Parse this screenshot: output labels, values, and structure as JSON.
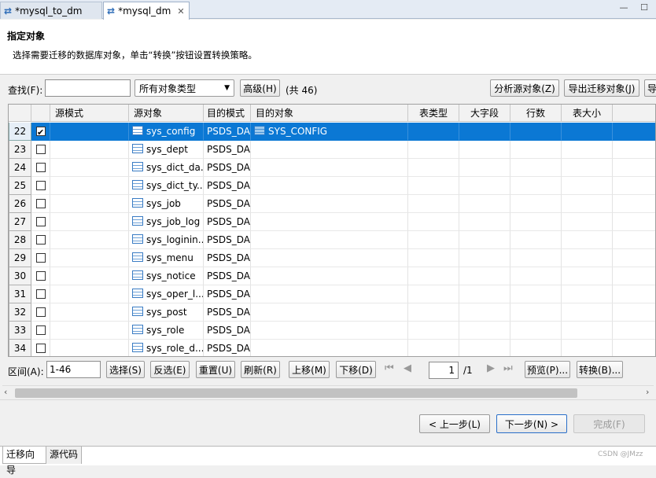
{
  "tabs": [
    {
      "label": "*mysql_to_dm",
      "active": false
    },
    {
      "label": "*mysql_dm",
      "active": true
    }
  ],
  "header": {
    "title": "指定对象",
    "description": "选择需要迁移的数据库对象，单击“转换”按钮设置转换策略。"
  },
  "toolbar": {
    "find_label": "查找(F):",
    "find_value": "",
    "type_select": "所有对象类型",
    "advanced_label": "高级(H)",
    "count_label": "(共 46)",
    "analyze_label": "分析源对象(Z)",
    "export_label": "导出迁移对象(J)",
    "cut_label": "导"
  },
  "table": {
    "columns": [
      "源模式",
      "源对象",
      "目的模式",
      "目的对象",
      "表类型",
      "大字段",
      "行数",
      "表大小"
    ],
    "rows": [
      {
        "num": "22",
        "checked": true,
        "src_schema": "",
        "src_obj": "sys_config",
        "dst_schema": "PSDS_DA.",
        "dst_obj": "SYS_CONFIG",
        "selected": true
      },
      {
        "num": "23",
        "checked": false,
        "src_schema": "",
        "src_obj": "sys_dept",
        "dst_schema": "PSDS_DA.",
        "dst_obj": ""
      },
      {
        "num": "24",
        "checked": false,
        "src_schema": "",
        "src_obj": "sys_dict_da..",
        "dst_schema": "PSDS_DA.",
        "dst_obj": ""
      },
      {
        "num": "25",
        "checked": false,
        "src_schema": "",
        "src_obj": "sys_dict_ty...",
        "dst_schema": "PSDS_DA.",
        "dst_obj": ""
      },
      {
        "num": "26",
        "checked": false,
        "src_schema": "",
        "src_obj": "sys_job",
        "dst_schema": "PSDS_DA.",
        "dst_obj": ""
      },
      {
        "num": "27",
        "checked": false,
        "src_schema": "",
        "src_obj": "sys_job_log",
        "dst_schema": "PSDS_DA.",
        "dst_obj": ""
      },
      {
        "num": "28",
        "checked": false,
        "src_schema": "",
        "src_obj": "sys_loginin...",
        "dst_schema": "PSDS_DA.",
        "dst_obj": ""
      },
      {
        "num": "29",
        "checked": false,
        "src_schema": "",
        "src_obj": "sys_menu",
        "dst_schema": "PSDS_DA.",
        "dst_obj": ""
      },
      {
        "num": "30",
        "checked": false,
        "src_schema": "",
        "src_obj": "sys_notice",
        "dst_schema": "PSDS_DA.",
        "dst_obj": ""
      },
      {
        "num": "31",
        "checked": false,
        "src_schema": "",
        "src_obj": "sys_oper_l...",
        "dst_schema": "PSDS_DA.",
        "dst_obj": ""
      },
      {
        "num": "32",
        "checked": false,
        "src_schema": "",
        "src_obj": "sys_post",
        "dst_schema": "PSDS_DA.",
        "dst_obj": ""
      },
      {
        "num": "33",
        "checked": false,
        "src_schema": "",
        "src_obj": "sys_role",
        "dst_schema": "PSDS_DA.",
        "dst_obj": ""
      },
      {
        "num": "34",
        "checked": false,
        "src_schema": "",
        "src_obj": "sys_role_d...",
        "dst_schema": "PSDS_DA.",
        "dst_obj": ""
      }
    ]
  },
  "range_bar": {
    "range_label": "区间(A):",
    "range_value": "1-46",
    "select_label": "选择(S)",
    "invert_label": "反选(E)",
    "reset_label": "重置(U)",
    "refresh_label": "刷新(R)",
    "up_label": "上移(M)",
    "down_label": "下移(D)",
    "page_value": "1",
    "page_total": "/1",
    "preview_label": "预览(P)...",
    "convert_label": "转换(B)..."
  },
  "wizard": {
    "prev_label": "< 上一步(L)",
    "next_label": "下一步(N) >",
    "finish_label": "完成(F)"
  },
  "bottom_tabs": [
    "迁移向导",
    "源代码"
  ],
  "watermark": "CSDN @JMzz",
  "colors": {
    "selection": "#0b78d4",
    "accent": "#2e6db8"
  }
}
